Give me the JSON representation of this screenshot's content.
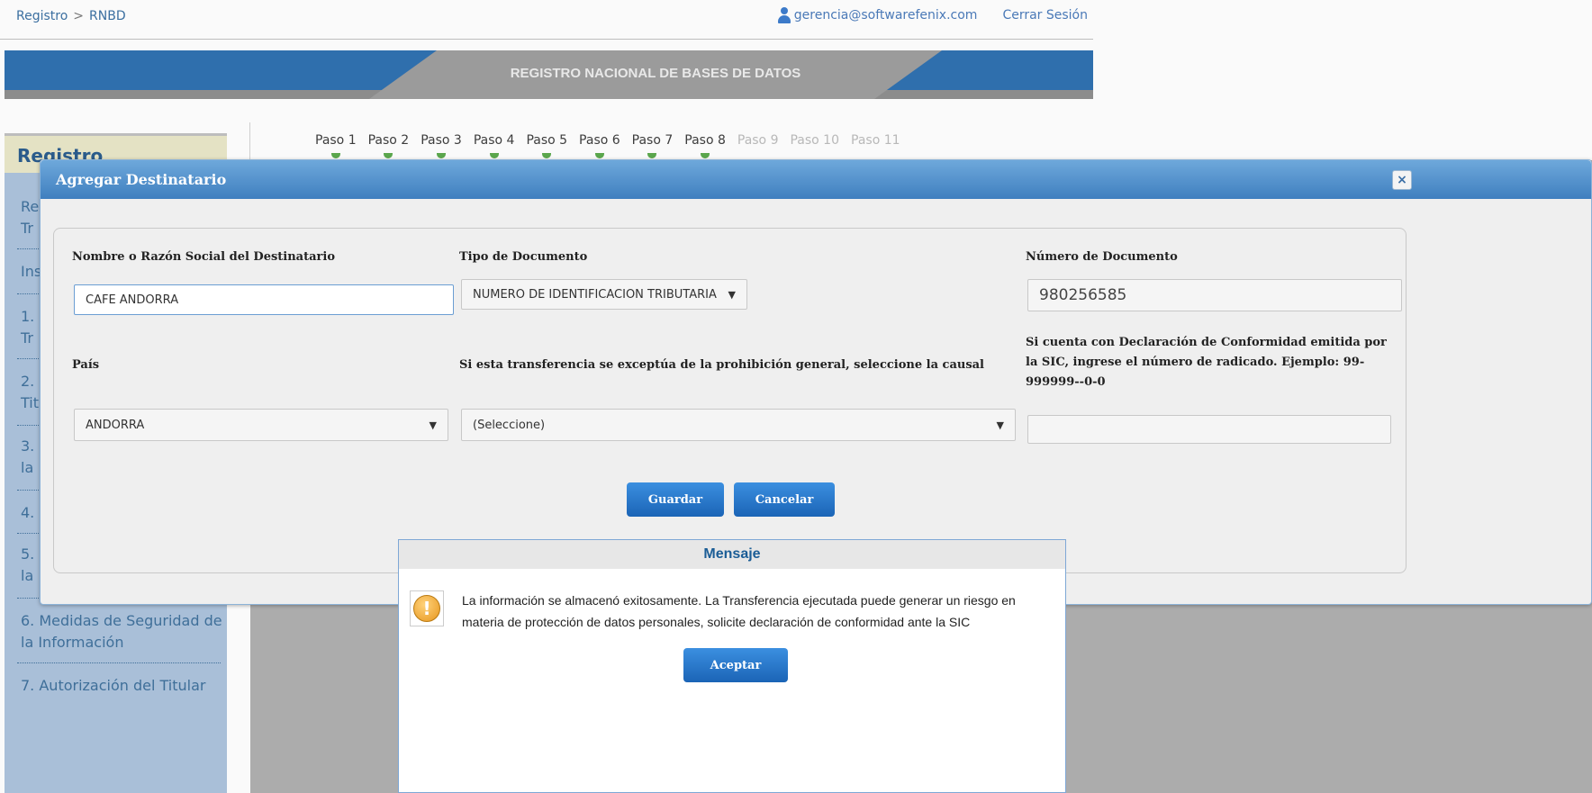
{
  "breadcrumb": {
    "root": "Registro",
    "separator": ">",
    "current": "RNBD"
  },
  "user": {
    "email": "gerencia@softwarefenix.com",
    "logout": "Cerrar Sesión"
  },
  "banner": {
    "title": "REGISTRO NACIONAL DE BASES DE DATOS"
  },
  "sidebar": {
    "title": "Registro",
    "items": [
      {
        "line1": "Re",
        "line2": "Tr"
      },
      {
        "line1": "Ins",
        "line2": ""
      },
      {
        "line1": "1.",
        "line2": "Tr"
      },
      {
        "line1": "2.",
        "line2": "Tit"
      },
      {
        "line1": "3.",
        "line2": "la"
      },
      {
        "line1": "4.",
        "line2": ""
      },
      {
        "line1": "5.",
        "line2": "la"
      },
      {
        "line1": "6. Medidas de Seguridad de",
        "line2": "la Información"
      },
      {
        "line1": "7. Autorización del Titular",
        "line2": ""
      }
    ]
  },
  "steps": [
    {
      "label": "Paso 1",
      "enabled": true
    },
    {
      "label": "Paso 2",
      "enabled": true
    },
    {
      "label": "Paso 3",
      "enabled": true
    },
    {
      "label": "Paso 4",
      "enabled": true
    },
    {
      "label": "Paso 5",
      "enabled": true
    },
    {
      "label": "Paso 6",
      "enabled": true
    },
    {
      "label": "Paso 7",
      "enabled": true
    },
    {
      "label": "Paso 8",
      "enabled": true
    },
    {
      "label": "Paso 9",
      "enabled": false
    },
    {
      "label": "Paso 10",
      "enabled": false
    },
    {
      "label": "Paso 11",
      "enabled": false
    }
  ],
  "dialog": {
    "title": "Agregar Destinatario",
    "close": "×",
    "fields": {
      "nombre_label": "Nombre o Razón Social del Destinatario",
      "nombre_value": "CAFE ANDORRA",
      "tipo_label": "Tipo de Documento",
      "tipo_value": "NUMERO DE IDENTIFICACION TRIBUTARIA",
      "numero_label": "Número de Documento",
      "numero_value": "980256585",
      "pais_label": "País",
      "pais_value": "ANDORRA",
      "causal_label": "Si esta transferencia se exceptúa de la prohibición general, seleccione la causal",
      "causal_value": "(Seleccione)",
      "radicado_label": "Si cuenta con Declaración de Conformidad emitida por la SIC, ingrese el número de radicado. Ejemplo: 99-999999--0-0",
      "radicado_value": ""
    },
    "buttons": {
      "save": "Guardar",
      "cancel": "Cancelar"
    }
  },
  "message": {
    "title": "Mensaje",
    "text": "La información se almacenó exitosamente. La Transferencia ejecutada puede generar un riesgo en materia de protección de datos personales, solicite declaración de conformidad ante la SIC",
    "accept": "Aceptar",
    "icon": "warning-icon"
  },
  "colors": {
    "primary": "#2f6fad",
    "button": "#1b64b6",
    "sidebar": "#a9bfd8"
  }
}
